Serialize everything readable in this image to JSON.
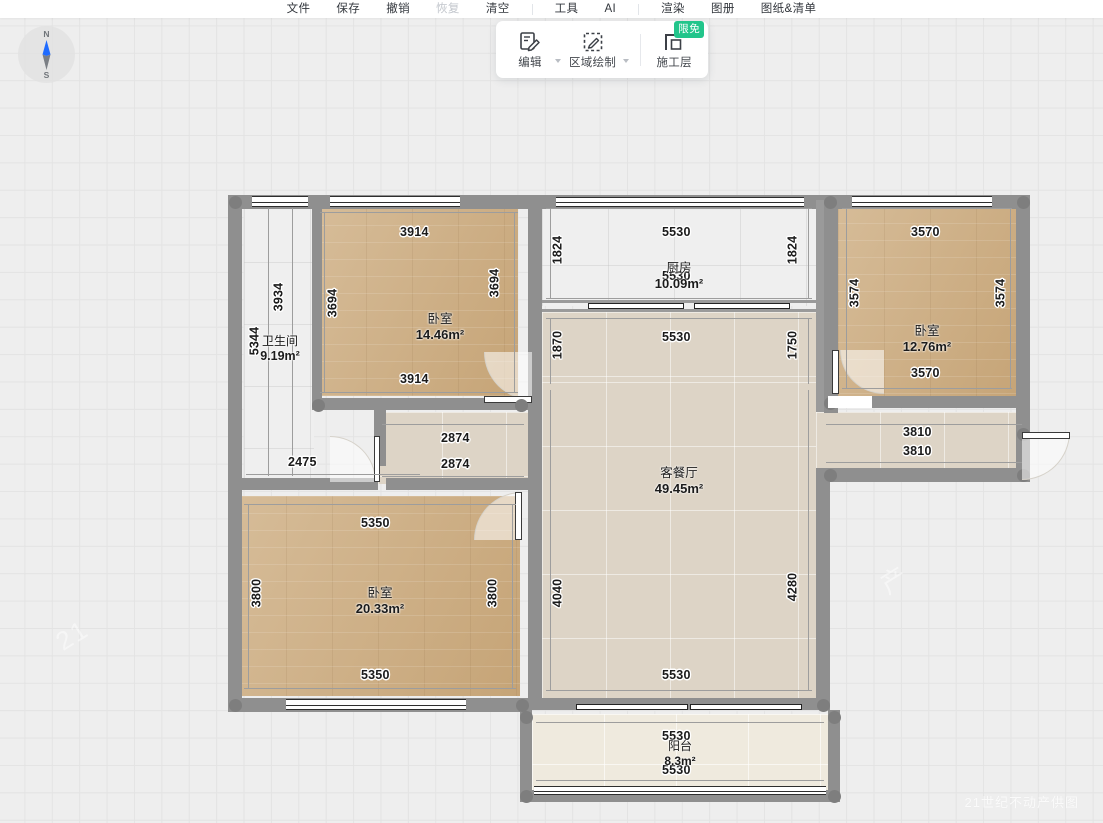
{
  "menubar": {
    "items": [
      {
        "label": "文件",
        "name": "menu-file",
        "disabled": false
      },
      {
        "label": "保存",
        "name": "menu-save",
        "disabled": false
      },
      {
        "label": "撤销",
        "name": "menu-undo",
        "disabled": false
      },
      {
        "label": "恢复",
        "name": "menu-redo",
        "disabled": true
      },
      {
        "label": "清空",
        "name": "menu-clear",
        "disabled": false
      },
      {
        "label": "工具",
        "name": "menu-tools",
        "disabled": false
      },
      {
        "label": "AI",
        "name": "menu-ai",
        "disabled": false
      },
      {
        "label": "渲染",
        "name": "menu-render",
        "disabled": false
      },
      {
        "label": "图册",
        "name": "menu-album",
        "disabled": false
      },
      {
        "label": "图纸&清单",
        "name": "menu-drawing-list",
        "disabled": false
      }
    ]
  },
  "toolbar": {
    "edit_label": "编辑",
    "area_draw_label": "区域绘制",
    "construction_layer_label": "施工层",
    "free_badge": "限免",
    "badge_color": "#22c58b"
  },
  "compass": {
    "north": "N",
    "south": "S",
    "needle_color": "#1f6bff"
  },
  "watermark": {
    "text": "21世纪不动产供图"
  },
  "floorplan": {
    "rooms": [
      {
        "name": "bedroom-top-left",
        "label": "卧室",
        "area": "14.46m²"
      },
      {
        "name": "bathroom",
        "label": "卫生间",
        "area": "9.19m²"
      },
      {
        "name": "kitchen",
        "label": "厨房",
        "area": "10.09m²"
      },
      {
        "name": "bedroom-right",
        "label": "卧室",
        "area": "12.76m²"
      },
      {
        "name": "living-dining",
        "label": "客餐厅",
        "area": "49.45m²"
      },
      {
        "name": "bedroom-bottom-left",
        "label": "卧室",
        "area": "20.33m²"
      },
      {
        "name": "balcony",
        "label": "阳台",
        "area": "8.3m²"
      }
    ],
    "dimensions": {
      "bedroom_tl_top": "3914",
      "bedroom_tl_bottom": "3914",
      "bedroom_tl_left": "3694",
      "bedroom_tl_right": "3694",
      "bathroom_left": "3934",
      "bathroom_right": "5344",
      "bathroom_bottom": "2475",
      "kitchen_top": "5530",
      "kitchen_left": "1824",
      "kitchen_right": "1824",
      "kitchen_center": "5530",
      "hall_top": "5530",
      "hall_left": "1870",
      "hall_right": "1750",
      "corridor_top": "2874",
      "corridor_bottom": "2874",
      "bedroom_r_top": "3570",
      "bedroom_r_bottom": "3570",
      "bedroom_r_left": "3574",
      "bedroom_r_right": "3574",
      "entry_top": "3810",
      "entry_bottom": "3810",
      "living_left": "4040",
      "living_right": "4280",
      "living_bottom": "5530",
      "bedroom_bl_top": "5350",
      "bedroom_bl_bottom": "5350",
      "bedroom_bl_left": "3800",
      "bedroom_bl_right": "3800",
      "balcony_top": "5530",
      "balcony_bottom": "5530"
    }
  }
}
